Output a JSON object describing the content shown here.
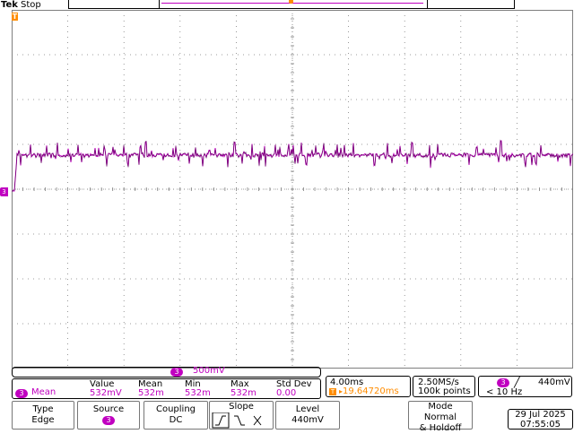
{
  "status": {
    "brand": "Tek",
    "state": "Stop"
  },
  "markers": {
    "trigger": "T",
    "channel": "3"
  },
  "scale": {
    "channel": "3",
    "value": "500mV"
  },
  "measurement": {
    "channel": "3",
    "type": "Mean",
    "headers": [
      "Value",
      "Mean",
      "Min",
      "Max",
      "Std Dev"
    ],
    "values": [
      "532mV",
      "532m",
      "532m",
      "532m",
      "0.00"
    ]
  },
  "horizontal": {
    "timebase": "4.00ms",
    "trigger_position": "19.64720ms"
  },
  "acquisition": {
    "sample_rate": "2.50MS/s",
    "record_length": "100k points"
  },
  "trigger": {
    "channel": "3",
    "slope": "rising",
    "level": "440mV",
    "frequency": "< 10 Hz"
  },
  "menu": {
    "type": {
      "title": "Type",
      "value": "Edge"
    },
    "source": {
      "title": "Source",
      "value": "3"
    },
    "coupling": {
      "title": "Coupling",
      "value": "DC"
    },
    "slope": {
      "title": "Slope"
    },
    "level": {
      "title": "Level",
      "value": "440mV"
    },
    "mode": {
      "title": "Mode",
      "value1": "Normal",
      "value2": "& Holdoff"
    }
  },
  "datetime": {
    "date": "29 Jul  2025",
    "time": "07:55:05"
  },
  "colors": {
    "ch3": "#c000c0",
    "trigger": "#ff8c00",
    "grid": "#7f7f7f"
  }
}
